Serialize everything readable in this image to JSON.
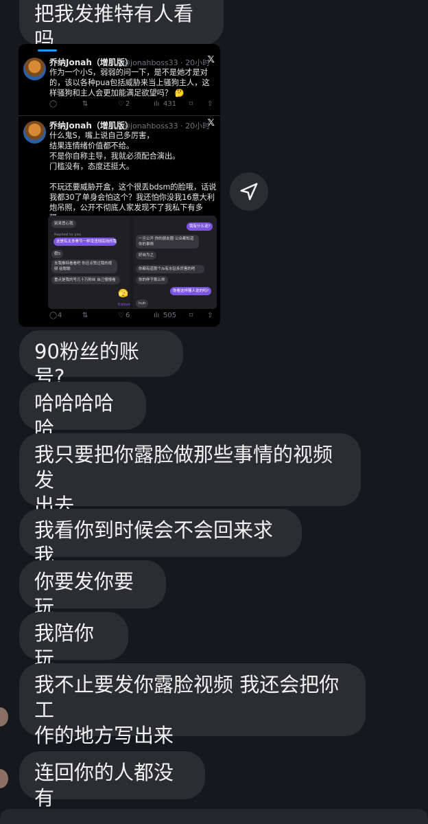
{
  "messages": [
    {
      "text": "把我发推特有人看吗"
    },
    {
      "text": "90粉丝的账号?"
    },
    {
      "text": "哈哈哈哈哈"
    },
    {
      "text": "我只要把你露脸做那些事情的视频发\n出去"
    },
    {
      "text": "我看你到时候会不会回来求我"
    },
    {
      "text": "你要发你要玩"
    },
    {
      "text": "我陪你玩"
    },
    {
      "text": "我不止要发你露脸视频 我还会把你工\n作的地方写出来"
    },
    {
      "text": "连回你的人都没有"
    }
  ],
  "screenshot": {
    "tweet1": {
      "name": "乔纳Jonah（增肌版）",
      "handle": "@jonahboss33 · 20小时",
      "x_logo": "𝕏",
      "body": "作为一个小S，弱弱的问一下，是不是她才是对的，该以各种pua包括威胁来当上骚狗主人，这样骚狗和主人会更加能满足欲望吗？ 🤔",
      "reply": "",
      "retweet": "",
      "likes": "2",
      "views": "431"
    },
    "tweet2": {
      "name": "乔纳Jonah（增肌版）",
      "handle": "@jonahboss33 · 20小时",
      "x_logo": "𝕏",
      "body": "什么鬼S，嘴上说自己多厉害，\n结果连情绪价值都不给。\n不是你自称主导，我就必须配合演出。\n门槛没有，态度还挺大。\n\n不玩还要威胁开盒，这个很丢bdsm的脸哦，话说我都30了单身会怕这个？我还怕你没我16意大利炮吊照，公开不彻底人家发现不了我私下有多骚。",
      "reply": "4",
      "retweet": "",
      "likes": "6",
      "views": "505"
    },
    "embed": {
      "left_msgs": [
        "别来恶心我",
        "Replied to you",
        "这是有太多骨节一样没违规底线的我s",
        "假S",
        "去我推特看看吧 你还点赞过我的视频 给聪聪",
        "重点是我的号几十万粉丝 自己慢慢看",
        "🫣",
        "Edited"
      ],
      "right_msgs": [
        "我有什么说?",
        "一旦公开 你的朋友圈 公众都知道你的事情",
        "好自为之",
        "你都有道那个/b有水钻多厉害的吧",
        "你的样子那么帅",
        "你看这样骚人说的吗?",
        "huh"
      ]
    }
  },
  "icons": {
    "share": "send-arrow-icon",
    "reply": "comment-icon",
    "retweet": "retweet-icon",
    "like": "heart-icon",
    "views": "bar-chart-icon",
    "bookmark": "bookmark-icon",
    "share_tweet": "share-icon"
  },
  "colors": {
    "background": "#15181d",
    "bubble": "#2b2d31",
    "purple_bubble": "#7b55e0"
  }
}
